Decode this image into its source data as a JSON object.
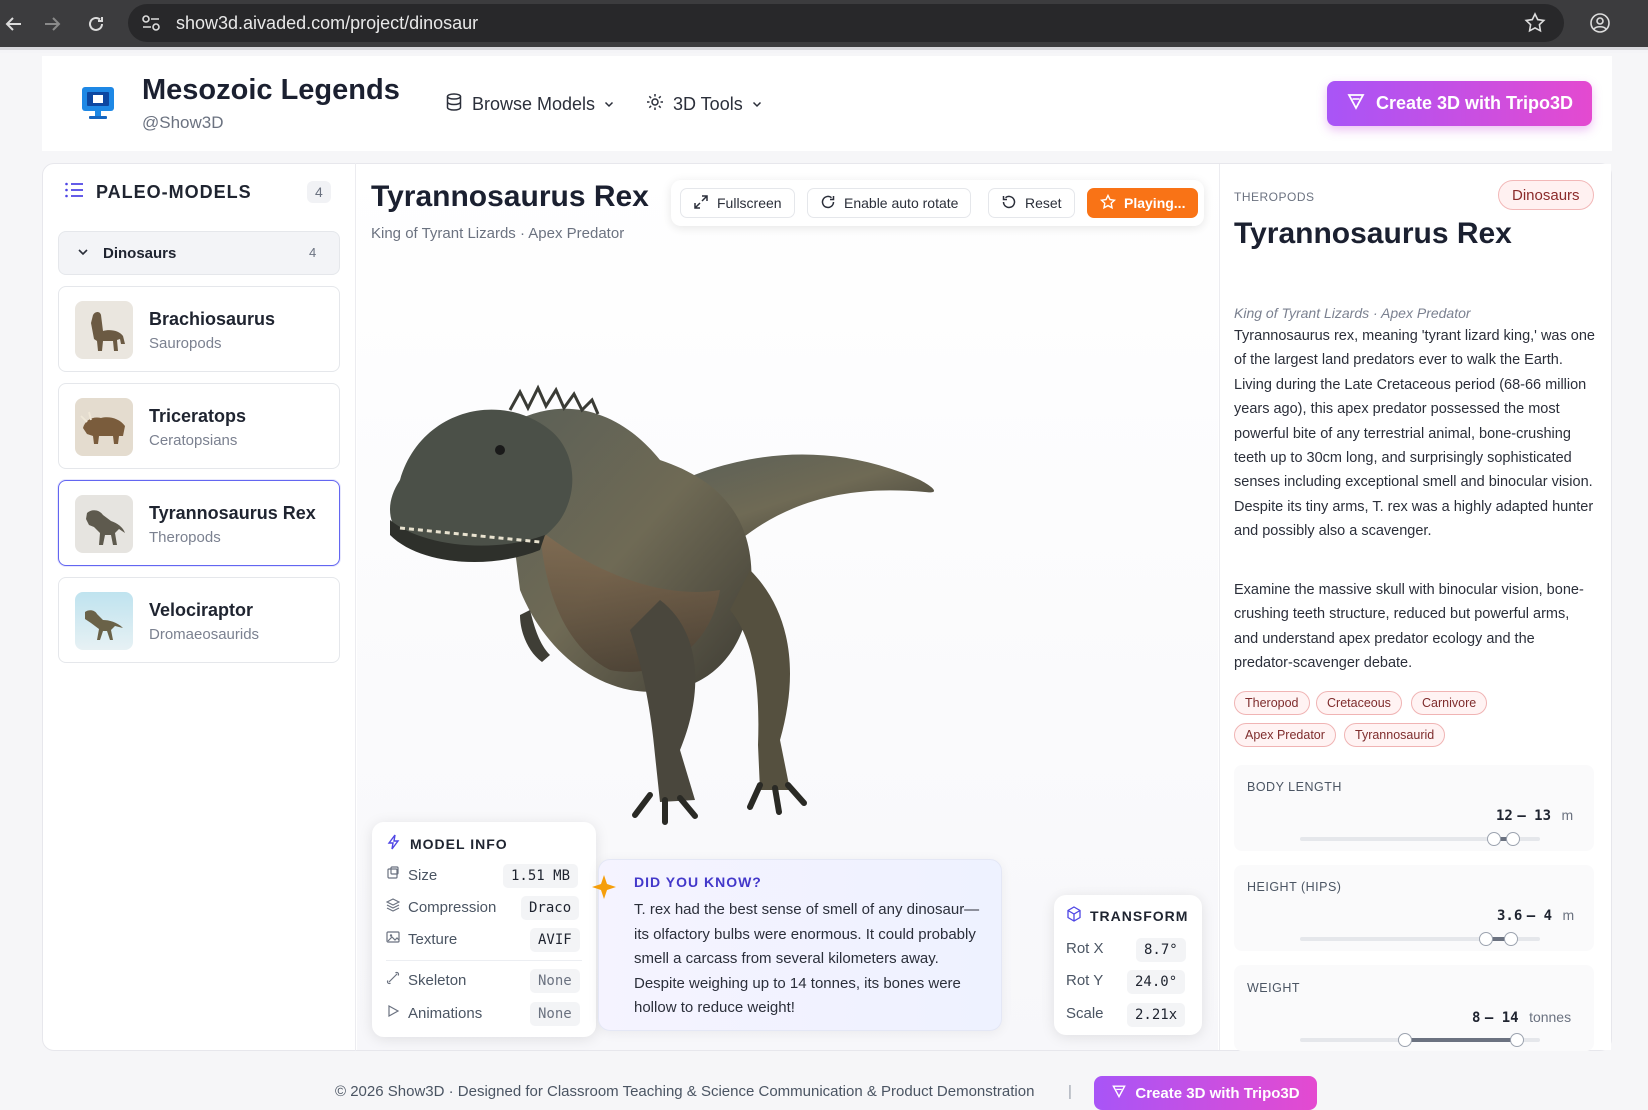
{
  "browser": {
    "url": "show3d.aivaded.com/project/dinosaur"
  },
  "header": {
    "brand": "Mesozoic Legends",
    "handle": "@Show3D",
    "nav": [
      {
        "label": "Browse Models",
        "icon": "database-icon"
      },
      {
        "label": "3D Tools",
        "icon": "gear-icon"
      }
    ],
    "cta_label": "Create 3D with Tripo3D"
  },
  "sidebar": {
    "heading": "PALEO-MODELS",
    "count": "4",
    "category": {
      "label": "Dinosaurs",
      "count": "4"
    },
    "items": [
      {
        "name": "Brachiosaurus",
        "group": "Sauropods"
      },
      {
        "name": "Triceratops",
        "group": "Ceratopsians"
      },
      {
        "name": "Tyrannosaurus Rex",
        "group": "Theropods"
      },
      {
        "name": "Velociraptor",
        "group": "Dromaeosaurids"
      }
    ]
  },
  "viewer": {
    "title": "Tyrannosaurus Rex",
    "subtitle": "King of Tyrant Lizards · Apex Predator",
    "toolbar": {
      "fullscreen": "Fullscreen",
      "autorotate": "Enable auto rotate",
      "reset": "Reset",
      "playing": "Playing..."
    },
    "model_info": {
      "heading": "MODEL INFO",
      "rows": [
        {
          "label": "Size",
          "value": "1.51 MB"
        },
        {
          "label": "Compression",
          "value": "Draco"
        },
        {
          "label": "Texture",
          "value": "AVIF"
        },
        {
          "label": "Skeleton",
          "value": "None"
        },
        {
          "label": "Animations",
          "value": "None"
        }
      ]
    },
    "did_you_know": {
      "heading": "DID YOU KNOW?",
      "text": "T. rex had the best sense of smell of any dinosaur—its olfactory bulbs were enormous. It could probably smell a carcass from several kilometers away. Despite weighing up to 14 tonnes, its bones were hollow to reduce weight!"
    },
    "transform": {
      "heading": "TRANSFORM",
      "rows": [
        {
          "label": "Rot X",
          "value": "8.7°"
        },
        {
          "label": "Rot Y",
          "value": "24.0°"
        },
        {
          "label": "Scale",
          "value": "2.21x"
        }
      ]
    }
  },
  "details": {
    "section": "THEROPODS",
    "badge": "Dinosaurs",
    "title": "Tyrannosaurus Rex",
    "subtitle": "King of Tyrant Lizards · Apex Predator",
    "paragraph1": "Tyrannosaurus rex, meaning 'tyrant lizard king,' was one of the largest land predators ever to walk the Earth. Living during the Late Cretaceous period (68-66 million years ago), this apex predator possessed the most powerful bite of any terrestrial animal, bone-crushing teeth up to 30cm long, and surprisingly sophisticated senses including exceptional smell and binocular vision. Despite its tiny arms, T. rex was a highly adapted hunter and possibly also a scavenger.",
    "paragraph2": "Examine the massive skull with binocular vision, bone-crushing teeth structure, reduced but powerful arms, and understand apex predator ecology and the predator-scavenger debate.",
    "tags": [
      "Theropod",
      "Cretaceous",
      "Carnivore",
      "Apex Predator",
      "Tyrannosaurid"
    ],
    "stats": [
      {
        "label": "BODY LENGTH",
        "min": "12",
        "max": "13",
        "unit": "m"
      },
      {
        "label": "HEIGHT (HIPS)",
        "min": "3.6",
        "max": "4",
        "unit": "m"
      },
      {
        "label": "WEIGHT",
        "min": "8",
        "max": "14",
        "unit": "tonnes"
      }
    ]
  },
  "footer": {
    "text": "© 2026 Show3D · Designed for Classroom Teaching & Science Communication & Product Demonstration",
    "separator": "|",
    "cta_label": "Create 3D with Tripo3D"
  },
  "colors": {
    "accent_gradient_start": "#a855f7",
    "accent_gradient_end": "#e44ad0",
    "playing": "#f97316",
    "active_border": "#6366f1",
    "tag_border": "#f0b4b4"
  }
}
